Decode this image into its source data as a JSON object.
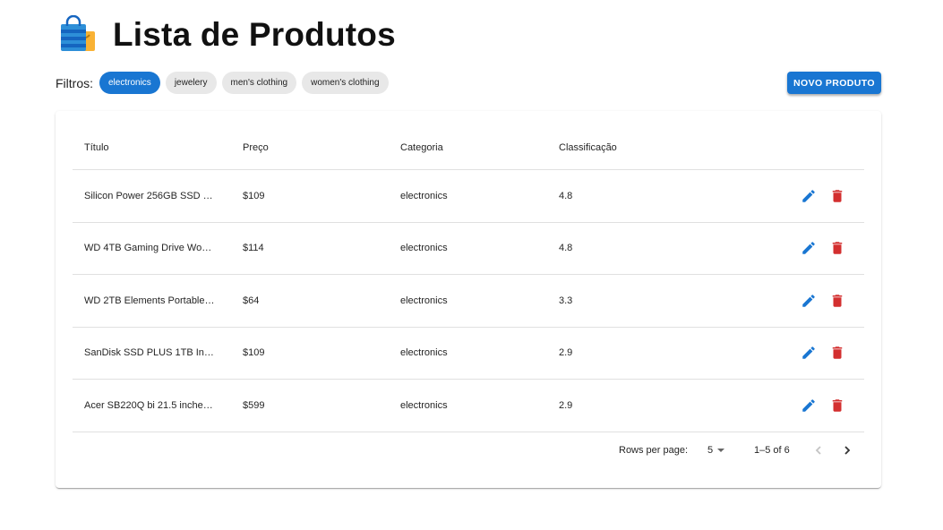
{
  "header": {
    "title": "Lista de Produtos",
    "icon": "shopping-bags-icon"
  },
  "filters": {
    "label": "Filtros:",
    "chips": [
      "electronics",
      "jewelery",
      "men's clothing",
      "women's clothing"
    ],
    "active": "electronics"
  },
  "toolbar": {
    "new_label": "NOVO PRODUTO"
  },
  "table": {
    "headers": [
      "Título",
      "Preço",
      "Categoria",
      "Classificação"
    ],
    "rows": [
      {
        "title": "Silicon Power 256GB SSD …",
        "price": "$109",
        "category": "electronics",
        "rating": "4.8"
      },
      {
        "title": "WD 4TB Gaming Drive Wo…",
        "price": "$114",
        "category": "electronics",
        "rating": "4.8"
      },
      {
        "title": "WD 2TB Elements Portable…",
        "price": "$64",
        "category": "electronics",
        "rating": "3.3"
      },
      {
        "title": "SanDisk SSD PLUS 1TB In…",
        "price": "$109",
        "category": "electronics",
        "rating": "2.9"
      },
      {
        "title": "Acer SB220Q bi 21.5 inche…",
        "price": "$599",
        "category": "electronics",
        "rating": "2.9"
      }
    ]
  },
  "pagination": {
    "rows_per_page_label": "Rows per page:",
    "rows_per_page": "5",
    "range": "1–5 of 6"
  },
  "colors": {
    "primary": "#1976d2",
    "delete": "#d32f2f",
    "chip_bg": "#e8e8e8"
  }
}
